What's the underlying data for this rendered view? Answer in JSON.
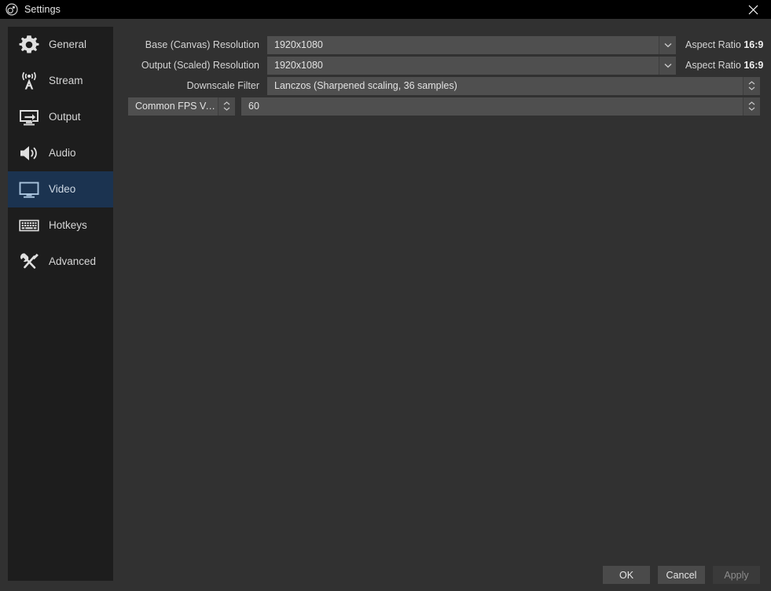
{
  "window": {
    "title": "Settings",
    "app_icon": "obs-logo-icon",
    "close_icon": "close-icon"
  },
  "sidebar": {
    "items": [
      {
        "label": "General",
        "icon": "gear-icon",
        "selected": false
      },
      {
        "label": "Stream",
        "icon": "broadcast-icon",
        "selected": false
      },
      {
        "label": "Output",
        "icon": "monitor-arrow-icon",
        "selected": false
      },
      {
        "label": "Audio",
        "icon": "speaker-icon",
        "selected": false
      },
      {
        "label": "Video",
        "icon": "monitor-icon",
        "selected": true
      },
      {
        "label": "Hotkeys",
        "icon": "keyboard-icon",
        "selected": false
      },
      {
        "label": "Advanced",
        "icon": "tools-icon",
        "selected": false
      }
    ]
  },
  "form": {
    "base_resolution": {
      "label": "Base (Canvas) Resolution",
      "value": "1920x1080",
      "aspect_label": "Aspect Ratio",
      "aspect_value": "16:9",
      "arrow_icon": "chevron-down-icon"
    },
    "output_resolution": {
      "label": "Output (Scaled) Resolution",
      "value": "1920x1080",
      "aspect_label": "Aspect Ratio",
      "aspect_value": "16:9",
      "arrow_icon": "chevron-down-icon"
    },
    "downscale_filter": {
      "label": "Downscale Filter",
      "value": "Lanczos (Sharpened scaling, 36 samples)",
      "spinner_icon": "spinner-up-down-icon"
    },
    "fps": {
      "type_label": "Common FPS Values",
      "type_spinner_icon": "spinner-up-down-icon",
      "value": "60",
      "value_spinner_icon": "spinner-up-down-icon"
    }
  },
  "footer": {
    "ok_label": "OK",
    "cancel_label": "Cancel",
    "apply_label": "Apply",
    "apply_disabled": true
  },
  "colors": {
    "accent_selected": "#1b3350",
    "dialog_bg": "#313131",
    "sidebar_bg": "#1d1d1d",
    "field_bg": "#4f4f4f",
    "titlebar_bg": "#000000"
  }
}
